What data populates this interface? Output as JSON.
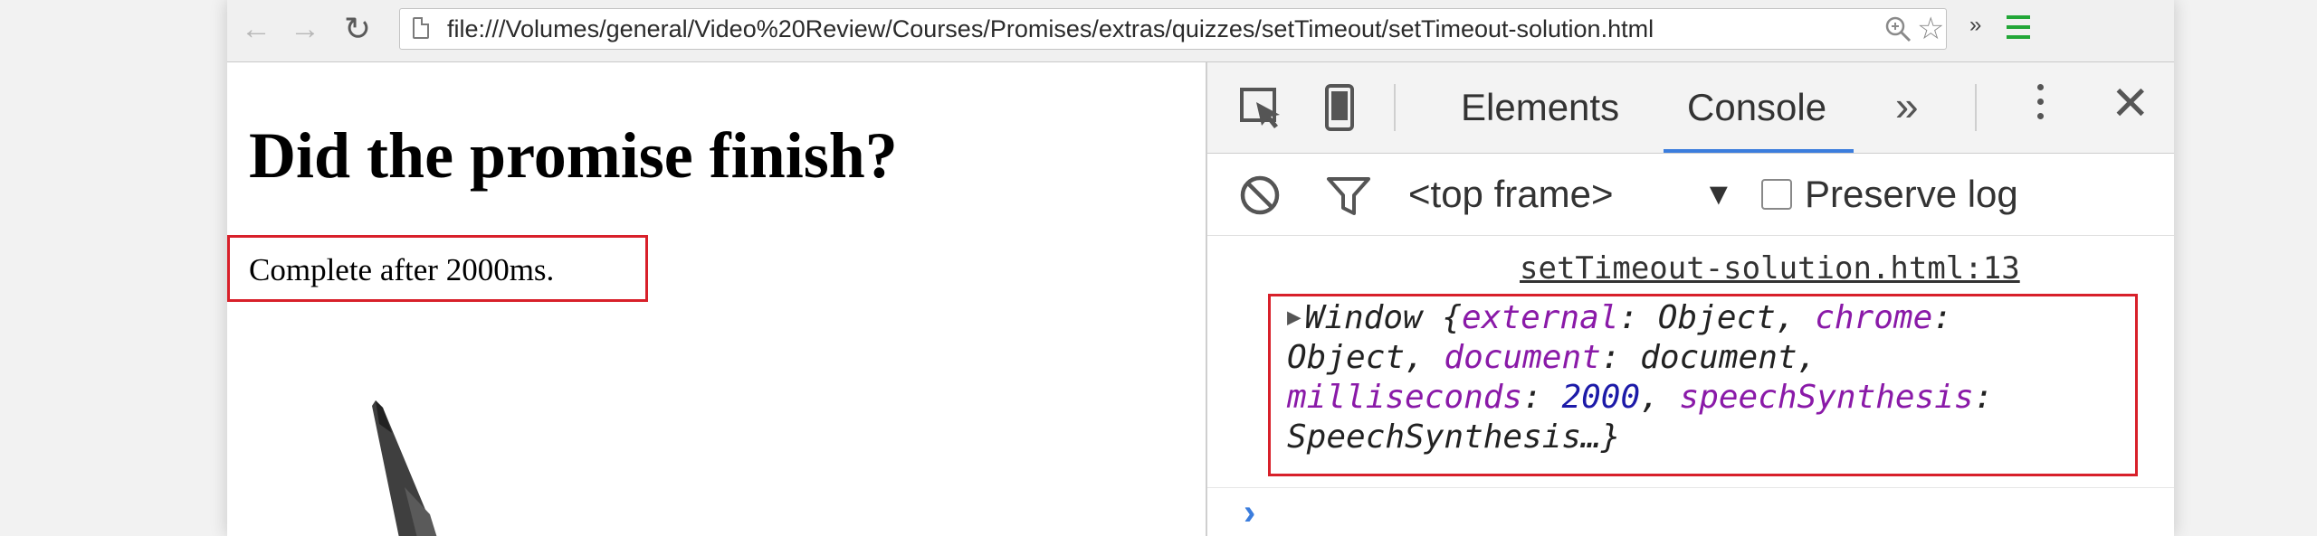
{
  "browser": {
    "url": "file:///Volumes/general/Video%20Review/Courses/Promises/extras/quizzes/setTimeout/setTimeout-solution.html",
    "back_icon": "←",
    "forward_icon": "→",
    "reload_icon": "↻",
    "extensions_more": "»"
  },
  "page": {
    "heading": "Did the promise finish?",
    "result": "Complete after 2000ms."
  },
  "devtools": {
    "tabs": [
      "Elements",
      "Console"
    ],
    "active_tab": "Console",
    "more_tabs": "»",
    "close": "✕",
    "context": "<top frame>",
    "context_arrow": "▼",
    "preserve_log_label": "Preserve log",
    "preserve_log_checked": false,
    "accent": "#3b7ddd"
  },
  "console": {
    "source": "setTimeout-solution.html:13",
    "log": {
      "expand_icon": "▶",
      "open": "Window {",
      "k1": "external",
      "v1": "Object",
      "k2": "chrome",
      "v2": "Object",
      "k3": "document",
      "v3": "document",
      "k4": "milliseconds",
      "v4": "2000",
      "k5": "speechSynthesis",
      "v5": "SpeechSynthesis",
      "close": "…}"
    },
    "prompt": "›"
  },
  "highlight_color": "#d8202a"
}
